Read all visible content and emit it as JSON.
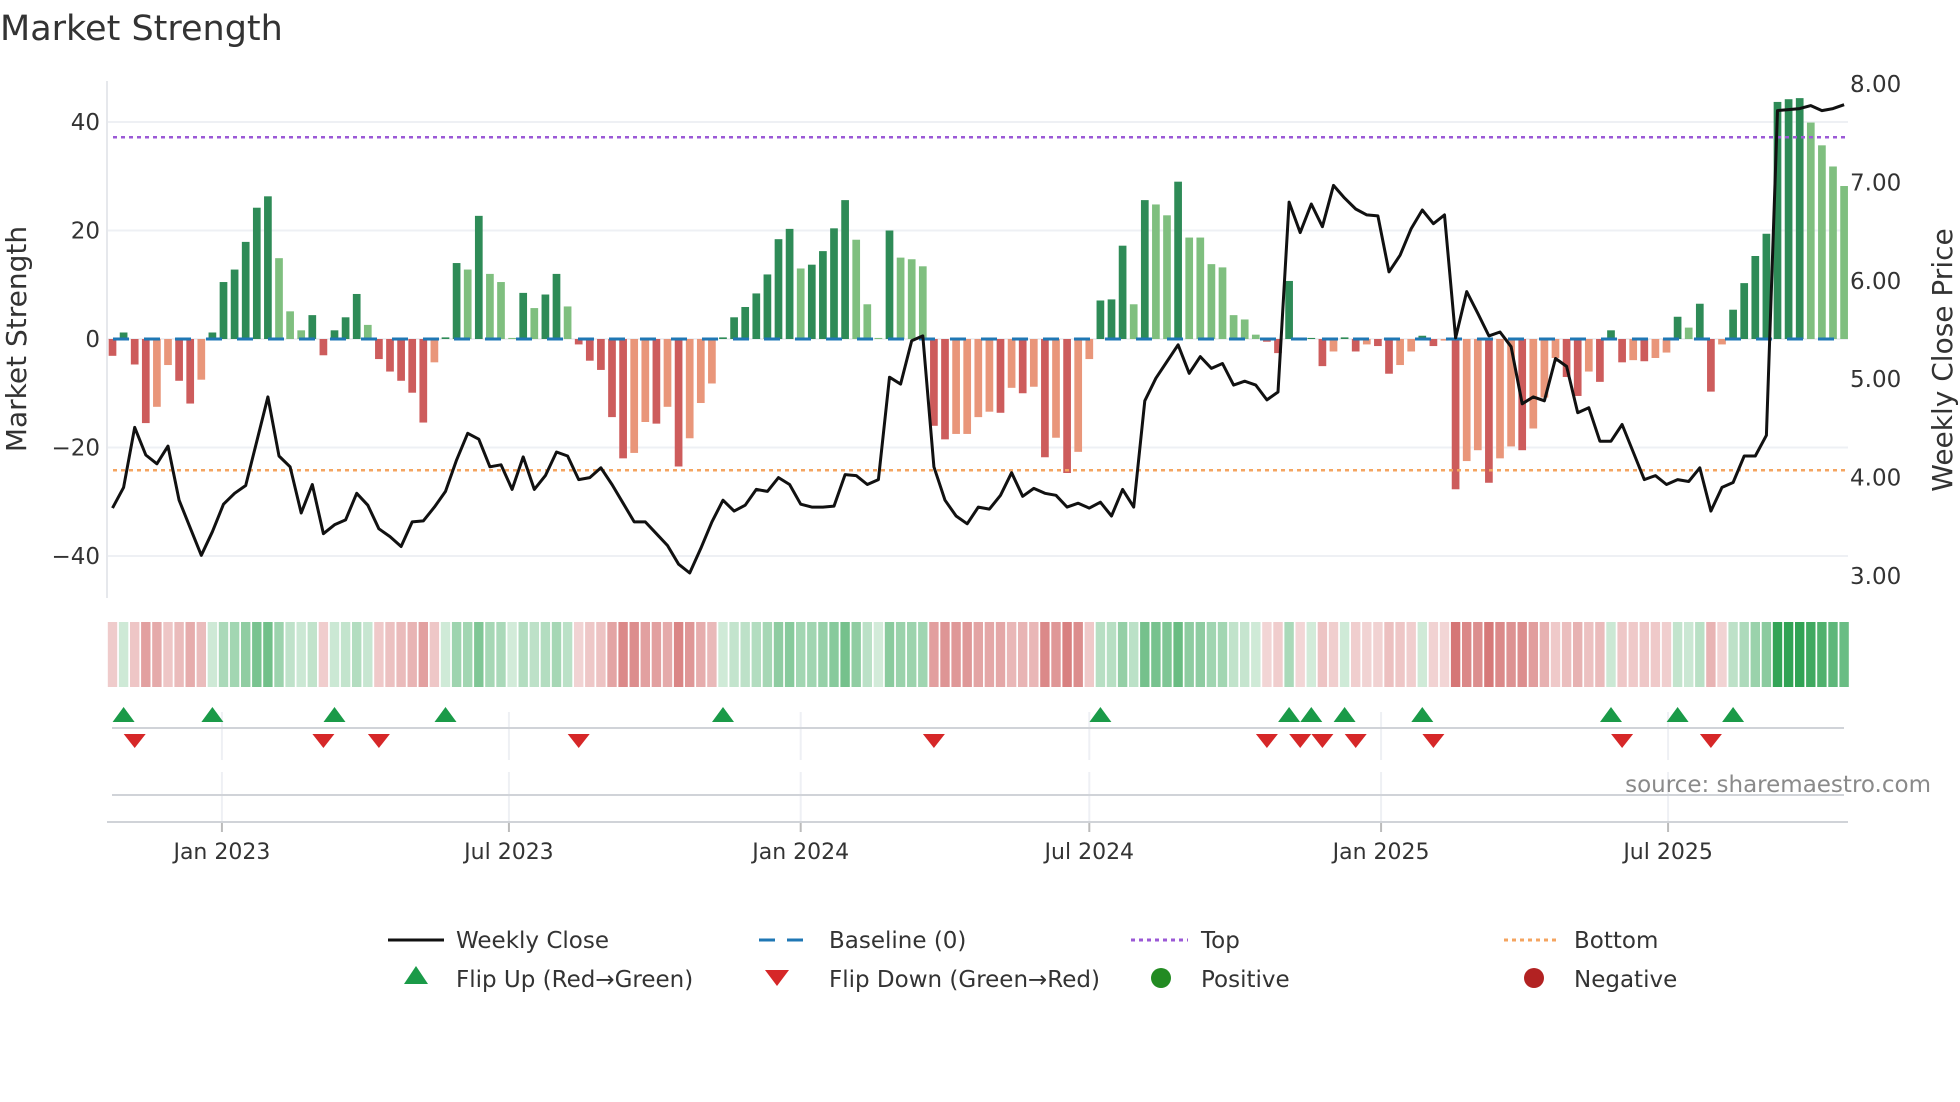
{
  "chart_data": {
    "type": "bar",
    "title": "Market Strength",
    "ylabel": "Market Strength",
    "y2label": "Weekly Close Price",
    "ylim": [
      -48,
      48
    ],
    "y2lim": [
      2.78,
      8.03
    ],
    "yticks": [
      40,
      20,
      0,
      -20,
      -40
    ],
    "ytick_labels": [
      "40",
      "20",
      "0",
      "−20",
      "−40"
    ],
    "y2ticks": [
      8,
      7,
      6,
      5,
      4,
      3
    ],
    "y2tick_labels": [
      "8.00",
      "7.00",
      "6.00",
      "5.00",
      "4.00",
      "3.00"
    ],
    "x_start": "2022-10-24",
    "x_step_days": 7,
    "xticks": [
      {
        "date": "2023-01-01",
        "label": "Jan 2023"
      },
      {
        "date": "2023-07-01",
        "label": "Jul 2023"
      },
      {
        "date": "2024-01-01",
        "label": "Jan 2024"
      },
      {
        "date": "2024-07-01",
        "label": "Jul 2024"
      },
      {
        "date": "2025-01-01",
        "label": "Jan 2025"
      },
      {
        "date": "2025-07-01",
        "label": "Jul 2025"
      }
    ],
    "top_level": 37.2,
    "bottom_level": -24.2,
    "grid": true,
    "strength": [
      -3.1,
      1.2,
      -4.7,
      -15.5,
      -12.5,
      -4.8,
      -7.7,
      -11.9,
      -7.5,
      1.2,
      10.5,
      12.8,
      17.9,
      24.2,
      26.3,
      14.9,
      5.1,
      1.6,
      4.4,
      -3,
      1.6,
      4,
      8.3,
      2.6,
      -3.7,
      -6,
      -7.7,
      -9.9,
      -15.4,
      -4.3,
      0.3,
      14,
      12.8,
      22.7,
      12,
      10.5,
      0.2,
      8.5,
      5.7,
      8.2,
      12,
      6,
      -1,
      -4,
      -5.7,
      -14.4,
      -22,
      -21,
      -15.3,
      -15.6,
      -12.5,
      -23.5,
      -18.3,
      -11.8,
      -8.2,
      0.3,
      4,
      5.9,
      8.4,
      11.9,
      18.4,
      20.3,
      13,
      13.7,
      16.2,
      20.4,
      25.6,
      18.3,
      6.4,
      0.2,
      20,
      15,
      14.7,
      13.4,
      -16,
      -18.5,
      -17.5,
      -17.5,
      -14.4,
      -13.4,
      -13.6,
      -9,
      -10,
      -8.8,
      -21.8,
      -18.2,
      -24.7,
      -20.8,
      -3.7,
      7.1,
      7.3,
      17.2,
      6.4,
      25.6,
      24.8,
      22.8,
      29,
      18.7,
      18.7,
      13.8,
      13.2,
      4.4,
      3.6,
      0.8,
      -0.5,
      -2.6,
      10.7,
      -0.2,
      0.2,
      -5,
      -2.3,
      0.3,
      -2.3,
      -1,
      -1.3,
      -6.4,
      -4.8,
      -2.3,
      0.6,
      -1.3,
      -0.3,
      -27.7,
      -22.5,
      -20.5,
      -26.5,
      -22,
      -19.8,
      -20.5,
      -16.5,
      -10.8,
      -3.5,
      -7,
      -10.5,
      -6,
      -7.9,
      1.6,
      -4.3,
      -3.9,
      -4.1,
      -3.5,
      -2.5,
      4.1,
      2.1,
      6.5,
      -9.7,
      -1,
      5.4,
      10.3,
      15.3,
      19.4,
      43.7,
      44.2,
      44.4,
      39.9,
      35.7,
      31.8,
      28.2
    ],
    "weekly_close": [
      3.69,
      3.9,
      4.51,
      4.23,
      4.14,
      4.32,
      3.77,
      3.49,
      3.21,
      3.45,
      3.73,
      3.84,
      3.92,
      4.37,
      4.82,
      4.22,
      4.11,
      3.64,
      3.93,
      3.43,
      3.52,
      3.57,
      3.84,
      3.72,
      3.48,
      3.4,
      3.3,
      3.55,
      3.56,
      3.7,
      3.86,
      4.18,
      4.45,
      4.39,
      4.11,
      4.13,
      3.88,
      4.21,
      3.88,
      4.02,
      4.26,
      4.22,
      3.98,
      4.0,
      4.1,
      3.93,
      3.74,
      3.55,
      3.55,
      3.43,
      3.31,
      3.12,
      3.03,
      3.28,
      3.55,
      3.77,
      3.66,
      3.72,
      3.88,
      3.86,
      4.0,
      3.93,
      3.73,
      3.7,
      3.7,
      3.71,
      4.03,
      4.02,
      3.93,
      3.98,
      5.02,
      4.95,
      5.39,
      5.44,
      4.11,
      3.77,
      3.61,
      3.53,
      3.7,
      3.68,
      3.82,
      4.05,
      3.81,
      3.89,
      3.84,
      3.82,
      3.7,
      3.74,
      3.69,
      3.75,
      3.61,
      3.88,
      3.7,
      4.78,
      5.01,
      5.18,
      5.35,
      5.06,
      5.23,
      5.11,
      5.16,
      4.94,
      4.98,
      4.94,
      4.79,
      4.87,
      6.8,
      6.49,
      6.78,
      6.55,
      6.97,
      6.84,
      6.73,
      6.67,
      6.66,
      6.09,
      6.26,
      6.53,
      6.72,
      6.58,
      6.67,
      5.42,
      5.89,
      5.67,
      5.44,
      5.48,
      5.33,
      4.75,
      4.82,
      4.78,
      5.21,
      5.13,
      4.66,
      4.71,
      4.37,
      4.37,
      4.54,
      4.26,
      3.98,
      4.02,
      3.93,
      3.98,
      3.96,
      4.1,
      3.66,
      3.9,
      3.95,
      4.22,
      4.22,
      4.43,
      7.73,
      7.74,
      7.75,
      7.78,
      7.73,
      7.75,
      7.79
    ],
    "legend": {
      "placement": "bottom",
      "items": [
        "Weekly Close",
        "Baseline (0)",
        "Top",
        "Bottom",
        "Flip Up (Red→Green)",
        "Flip Down (Green→Red)",
        "Positive",
        "Negative"
      ]
    },
    "source": "source: sharemaestro.com"
  },
  "colors": {
    "pos_strong": "#2e8b57",
    "pos_weak": "#7fbf7f",
    "neg_strong": "#cd5c5c",
    "neg_weak": "#e9967a",
    "close_line": "#111111",
    "baseline": "#1f77b4",
    "top": "#9b59d6",
    "bottom": "#f4a460",
    "flip_up": "#1a9a48",
    "flip_down": "#d62728",
    "positive": "#228b22",
    "negative": "#b22222",
    "grid": "#eef0f4"
  }
}
